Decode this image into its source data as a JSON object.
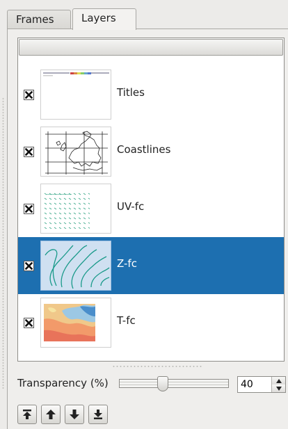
{
  "tabs": [
    {
      "label": "Frames",
      "active": false
    },
    {
      "label": "Layers",
      "active": true
    }
  ],
  "layers": [
    {
      "name": "Titles",
      "checked": true,
      "selected": false,
      "thumbnail": "titles-thumbnail"
    },
    {
      "name": "Coastlines",
      "checked": true,
      "selected": false,
      "thumbnail": "coastlines-map-thumbnail"
    },
    {
      "name": "UV-fc",
      "checked": true,
      "selected": false,
      "thumbnail": "wind-arrows-thumbnail"
    },
    {
      "name": "Z-fc",
      "checked": true,
      "selected": true,
      "thumbnail": "contour-lines-thumbnail"
    },
    {
      "name": "T-fc",
      "checked": true,
      "selected": false,
      "thumbnail": "temperature-shading-thumbnail"
    }
  ],
  "transparency": {
    "label": "Transparency (%)",
    "value": "40",
    "fraction": 0.4
  },
  "toolbar": {
    "buttons": [
      "move-to-top-icon",
      "move-up-icon",
      "move-down-icon",
      "move-to-bottom-icon"
    ]
  },
  "colors": {
    "selection": "#1d6fb0",
    "contour": "#1a9a8a"
  }
}
